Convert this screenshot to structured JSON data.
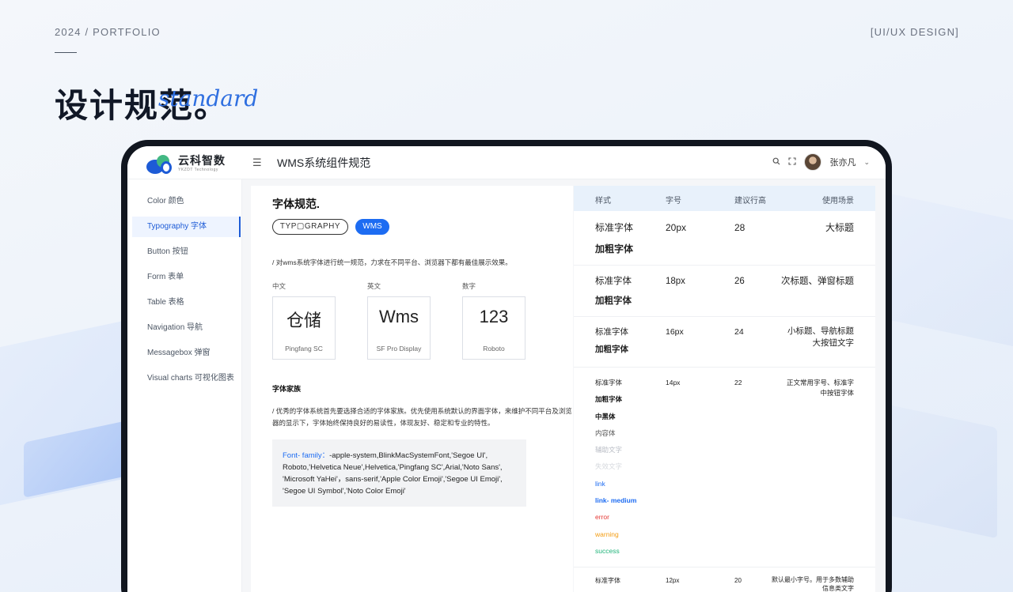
{
  "header": {
    "left_label": "2024 / PORTFOLIO",
    "right_label": "[UI/UX DESIGN]",
    "title_cn": "设计规范。",
    "title_en": "standard"
  },
  "app": {
    "logo_cn": "云科智数",
    "logo_en": "YKZDT Technology",
    "page_title": "WMS系统组件规范",
    "user_name": "张亦凡",
    "icons": [
      "menu-fold-icon",
      "search-icon",
      "fullscreen-icon",
      "avatar",
      "chevron-down-icon"
    ]
  },
  "sidebar": {
    "items": [
      {
        "label": "Color 颜色",
        "active": false
      },
      {
        "label": "Typography 字体",
        "active": true
      },
      {
        "label": "Button 按钮",
        "active": false
      },
      {
        "label": "Form 表单",
        "active": false
      },
      {
        "label": "Table 表格",
        "active": false
      },
      {
        "label": "Navigation 导航",
        "active": false
      },
      {
        "label": "Messagebox 弹窗",
        "active": false
      },
      {
        "label": "Visual charts 可视化图表",
        "active": false
      }
    ]
  },
  "typography": {
    "section_title": "字体规范.",
    "tag_outline": "TYP▢GRAPHY",
    "tag_filled": "WMS",
    "intro": "/    对wms系统字体进行统一规范，力求在不同平台、浏览器下都有最佳展示效果。",
    "samples": [
      {
        "label": "中文",
        "text": "仓储",
        "font": "Pingfang SC"
      },
      {
        "label": "英文",
        "text": "Wms",
        "font": "SF Pro Display"
      },
      {
        "label": "数字",
        "text": "123",
        "font": "Roboto"
      }
    ],
    "family_title": "字体家族",
    "family_desc": "/    优秀的字体系统首先要选择合适的字体家族。优先使用系统默认的界面字体，来维护不同平台及浏览器的显示下，字体始终保持良好的易读性，体现友好、稳定和专业的特性。",
    "code_key": "Font- family：",
    "code_value": "-apple-system,BlinkMacSystemFont,'Segoe UI', Roboto,'Helvetica Neue',Helvetica,'Pingfang SC',Arial,'Noto Sans', 'Microsoft YaHei'，sans-serif,'Apple Color Emoji','Segoe UI Emoji', 'Segoe UI Symbol','Noto Color Emoji'"
  },
  "table": {
    "headers": [
      "样式",
      "字号",
      "建议行高",
      "使用场景"
    ],
    "rows": [
      {
        "styles": [
          "标准字体",
          "加粗字体"
        ],
        "size": "20px",
        "line_height": "28",
        "usage": [
          "大标题"
        ]
      },
      {
        "styles": [
          "标准字体",
          "加粗字体"
        ],
        "size": "18px",
        "line_height": "26",
        "usage": [
          "次标题、弹窗标题"
        ]
      },
      {
        "styles": [
          "标准字体",
          "加粗字体"
        ],
        "size": "16px",
        "line_height": "24",
        "usage": [
          "小标题、导航标题",
          "大按钮文字"
        ]
      },
      {
        "styles": [
          "标准字体",
          "加粗字体",
          "中黑体",
          "内容体",
          "辅助文字",
          "失效文字",
          "link",
          "link- medium",
          "error",
          "warning",
          "success"
        ],
        "size": "14px",
        "line_height": "22",
        "usage": [
          "正文常用字号、标准字",
          "中按钮字体"
        ]
      },
      {
        "styles": [
          "标准字体"
        ],
        "size": "12px",
        "line_height": "20",
        "usage": [
          "默认最小字号。用于多数辅助",
          "信息类文字"
        ]
      }
    ],
    "style_colors": {
      "辅助文字": "#b8bcc4",
      "失效文字": "#d6d9de",
      "link": "#1d6cf2",
      "link- medium": "#1d6cf2",
      "error": "#e53935",
      "warning": "#f39c12",
      "success": "#21b47a"
    }
  },
  "colors": {
    "accent": "#1d6cf2",
    "brand_green": "#42b883"
  }
}
